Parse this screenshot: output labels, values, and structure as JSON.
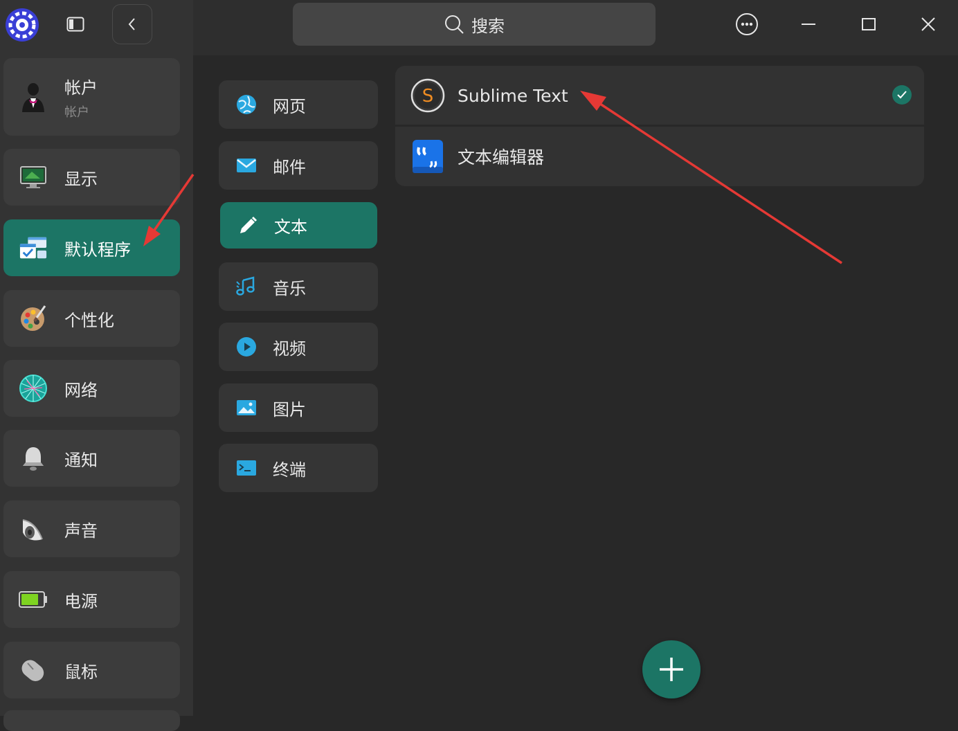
{
  "search": {
    "label": "搜索"
  },
  "sidebar": {
    "account": {
      "title": "帐户",
      "subtitle": "帐户"
    },
    "items": [
      {
        "label": "显示"
      },
      {
        "label": "默认程序"
      },
      {
        "label": "个性化"
      },
      {
        "label": "网络"
      },
      {
        "label": "通知"
      },
      {
        "label": "声音"
      },
      {
        "label": "电源"
      },
      {
        "label": "鼠标"
      }
    ]
  },
  "categories": [
    {
      "label": "网页"
    },
    {
      "label": "邮件"
    },
    {
      "label": "文本"
    },
    {
      "label": "音乐"
    },
    {
      "label": "视频"
    },
    {
      "label": "图片"
    },
    {
      "label": "终端"
    }
  ],
  "apps": [
    {
      "name": "Sublime Text",
      "icon_letter": "S",
      "default": true
    },
    {
      "name": "文本编辑器",
      "default": false
    }
  ],
  "colors": {
    "accent": "#1c7565",
    "annotation": "#e53935"
  }
}
